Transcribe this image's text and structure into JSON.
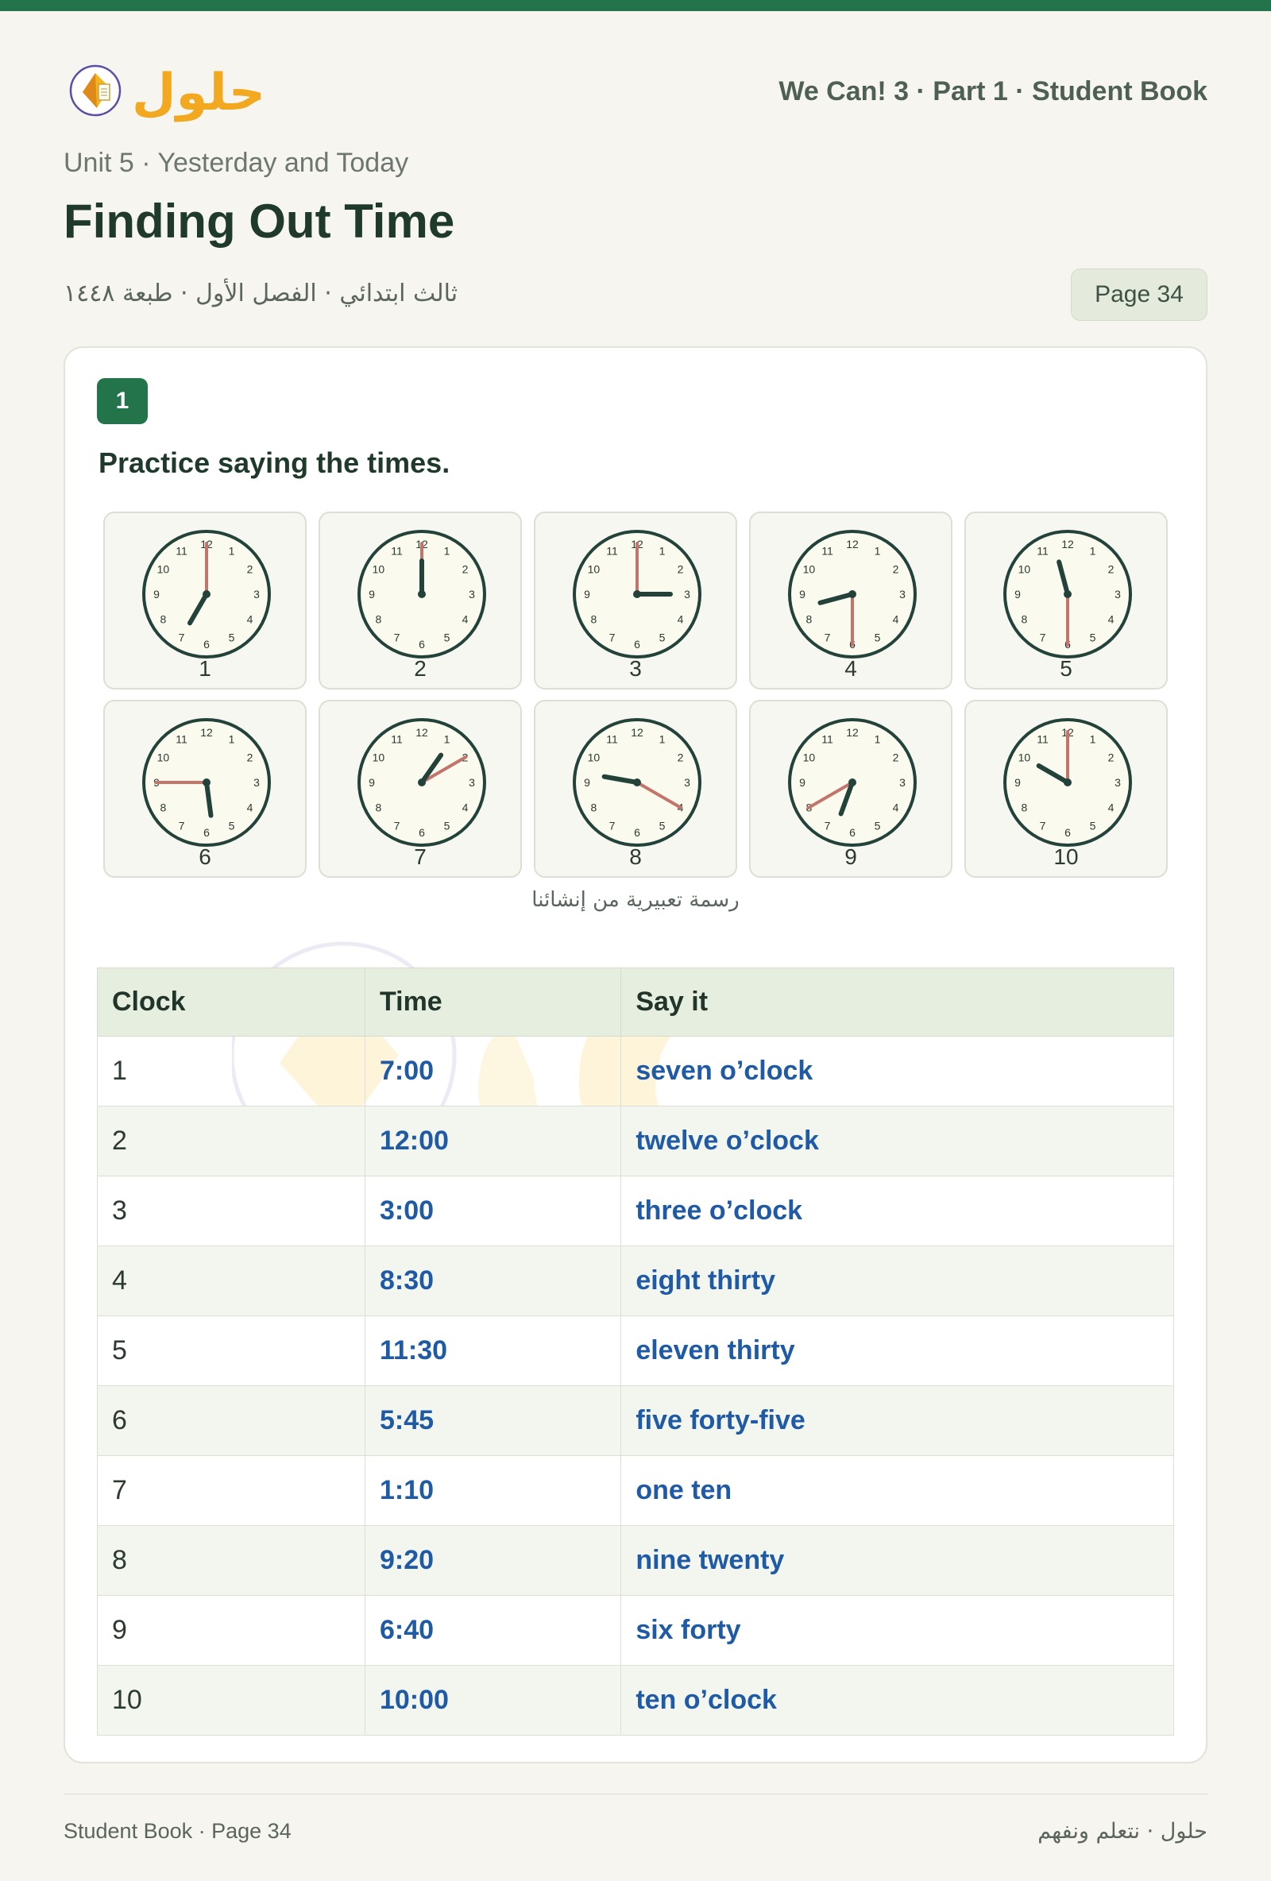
{
  "header": {
    "logo_text": "حلول",
    "book_title": "We Can! 3 · Part 1 · Student Book",
    "unit": "Unit 5 · Yesterday and Today",
    "title": "Finding Out Time",
    "arabic_meta": "ثالث ابتدائي · الفصل الأول · طبعة ١٤٤٨",
    "page": "Page 34"
  },
  "exercise": {
    "number": "1",
    "instruction": "Practice saying the times.",
    "caption": "رسمة تعبيرية من إنشائنا"
  },
  "clocks": [
    {
      "label": "1",
      "hour": 7,
      "minute": 0
    },
    {
      "label": "2",
      "hour": 12,
      "minute": 0
    },
    {
      "label": "3",
      "hour": 3,
      "minute": 0
    },
    {
      "label": "4",
      "hour": 8,
      "minute": 30
    },
    {
      "label": "5",
      "hour": 11,
      "minute": 30
    },
    {
      "label": "6",
      "hour": 5,
      "minute": 45
    },
    {
      "label": "7",
      "hour": 1,
      "minute": 10
    },
    {
      "label": "8",
      "hour": 9,
      "minute": 20
    },
    {
      "label": "9",
      "hour": 6,
      "minute": 40
    },
    {
      "label": "10",
      "hour": 10,
      "minute": 0
    }
  ],
  "clock_numerals": [
    "12",
    "1",
    "2",
    "3",
    "4",
    "5",
    "6",
    "7",
    "8",
    "9",
    "10",
    "11"
  ],
  "colors": {
    "hour_hand": "#23433a",
    "minute_hand": "#c4756a",
    "rim": "#23433a",
    "face": "#fbfaef",
    "accent": "#23734b"
  },
  "table": {
    "headers": [
      "Clock",
      "Time",
      "Say it"
    ],
    "rows": [
      [
        "1",
        "7:00",
        "seven o’clock"
      ],
      [
        "2",
        "12:00",
        "twelve o’clock"
      ],
      [
        "3",
        "3:00",
        "three o’clock"
      ],
      [
        "4",
        "8:30",
        "eight thirty"
      ],
      [
        "5",
        "11:30",
        "eleven thirty"
      ],
      [
        "6",
        "5:45",
        "five forty-five"
      ],
      [
        "7",
        "1:10",
        "one ten"
      ],
      [
        "8",
        "9:20",
        "nine twenty"
      ],
      [
        "9",
        "6:40",
        "six forty"
      ],
      [
        "10",
        "10:00",
        "ten o’clock"
      ]
    ]
  },
  "footer": {
    "left": "Student Book · Page 34",
    "right": "حلول · نتعلم ونفهم"
  }
}
